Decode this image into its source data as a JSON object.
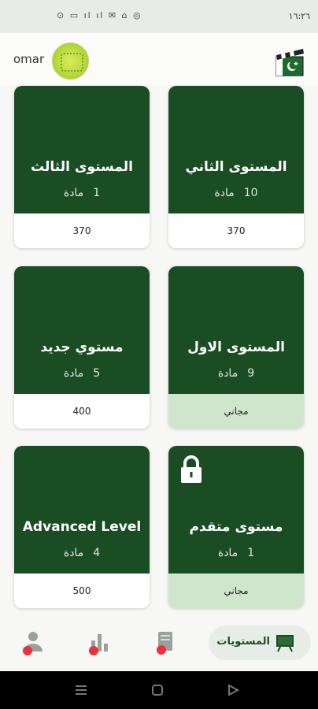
{
  "status_bar": {
    "time": "١٦:٢٦",
    "icons": "⊙ ▭ ıl ıl ✉ ⌂ ◎"
  },
  "header": {
    "username": "omar"
  },
  "cards": [
    {
      "title": "المستوى الثاني",
      "count": "10",
      "unit": "مادة",
      "price": "370",
      "free": false,
      "locked": false
    },
    {
      "title": "المستوى الثالث",
      "count": "1",
      "unit": "مادة",
      "price": "370",
      "free": false,
      "locked": false
    },
    {
      "title": "المستوى الاول",
      "count": "9",
      "unit": "مادة",
      "price": "مجاني",
      "free": true,
      "locked": false
    },
    {
      "title": "مستوي جديد",
      "count": "5",
      "unit": "مادة",
      "price": "400",
      "free": false,
      "locked": false
    },
    {
      "title": "مستوى متقدم",
      "count": "1",
      "unit": "مادة",
      "price": "مجاني",
      "free": true,
      "locked": true
    },
    {
      "title": "Advanced Level",
      "count": "4",
      "unit": "مادة",
      "price": "500",
      "free": false,
      "locked": false
    }
  ],
  "bottom_nav": {
    "active_label": "المستويات",
    "items": [
      "levels-board-icon",
      "notes-icon",
      "stats-icon",
      "profile-icon"
    ]
  },
  "colors": {
    "card_green": "#1b4d24",
    "free_band": "#cfe6cc"
  }
}
